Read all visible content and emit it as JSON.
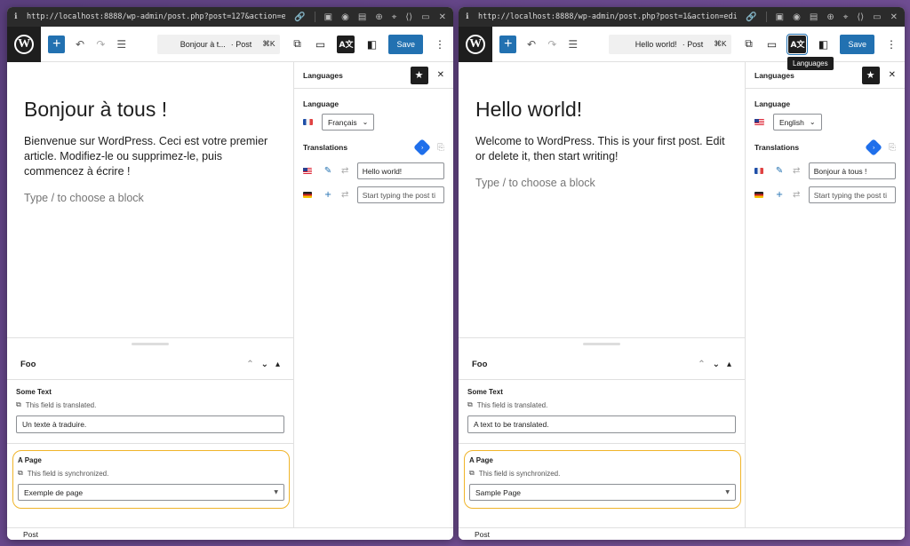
{
  "left": {
    "url": "http://localhost:8888/wp-admin/post.php?post=127&action=edit",
    "doc_title": "Bonjour à t...",
    "doc_type": "· Post",
    "shortcut": "⌘K",
    "save_label": "Save",
    "post": {
      "title": "Bonjour à tous !",
      "body": "Bienvenue sur WordPress. Ceci est votre premier article. Modifiez-le ou supprimez-le, puis commencez à écrire !",
      "placeholder": "Type / to choose a block"
    },
    "meta": {
      "box_title": "Foo",
      "field1_label": "Some Text",
      "field1_note": "This field is translated.",
      "field1_value": "Un texte à traduire.",
      "field2_label": "A Page",
      "field2_note": "This field is synchronized.",
      "field2_value": "Exemple de page"
    },
    "footer": "Post",
    "sidebar": {
      "title": "Languages",
      "language_label": "Language",
      "language_value": "Français",
      "translations_label": "Translations",
      "rows": [
        {
          "flag": "us",
          "action": "✎",
          "value": "Hello world!",
          "placeholder": false
        },
        {
          "flag": "de",
          "action": "+",
          "value": "Start typing the post ti",
          "placeholder": true
        }
      ]
    }
  },
  "right": {
    "url": "http://localhost:8888/wp-admin/post.php?post=1&action=edit",
    "doc_title": "Hello world!",
    "doc_type": "· Post",
    "shortcut": "⌘K",
    "save_label": "Save",
    "tooltip": "Languages",
    "post": {
      "title": "Hello world!",
      "body": "Welcome to WordPress. This is your first post. Edit or delete it, then start writing!",
      "placeholder": "Type / to choose a block"
    },
    "meta": {
      "box_title": "Foo",
      "field1_label": "Some Text",
      "field1_note": "This field is translated.",
      "field1_value": "A text to be translated.",
      "field2_label": "A Page",
      "field2_note": "This field is synchronized.",
      "field2_value": "Sample Page"
    },
    "footer": "Post",
    "sidebar": {
      "title": "Languages",
      "language_label": "Language",
      "language_value": "English",
      "translations_label": "Translations",
      "rows": [
        {
          "flag": "fr",
          "action": "✎",
          "value": "Bonjour à tous !",
          "placeholder": false
        },
        {
          "flag": "de",
          "action": "+",
          "value": "Start typing the post ti",
          "placeholder": true
        }
      ]
    }
  },
  "colors": {
    "wp_blue": "#2271b1",
    "highlight": "#f0b429",
    "dark": "#1e1e1e"
  }
}
